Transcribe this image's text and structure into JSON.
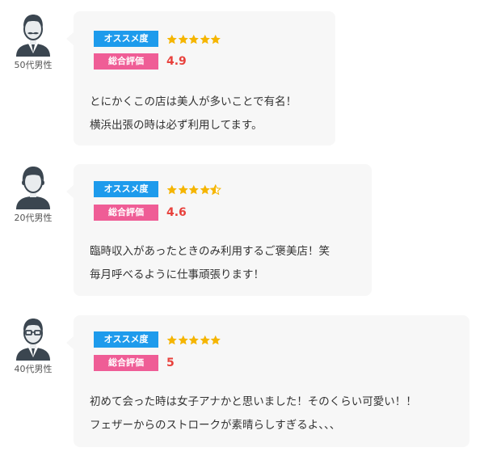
{
  "labels": {
    "recommend": "オススメ度",
    "overall": "総合評価"
  },
  "colors": {
    "recommend_tag": "#1e9bec",
    "overall_tag": "#ef5d96",
    "star": "#f5b500",
    "score_text": "#e8413c",
    "bubble_bg": "#f7f7f7",
    "avatar": "#3b4650"
  },
  "reviews": [
    {
      "age_label": "50代男性",
      "avatar_icon": "man-mustache-avatar-icon",
      "recommend_stars": 5,
      "overall_score": "4.9",
      "comment_lines": [
        "とにかくこの店は美人が多いことで有名！",
        "横浜出張の時は必ず利用してます。"
      ]
    },
    {
      "age_label": "20代男性",
      "avatar_icon": "young-man-avatar-icon",
      "recommend_stars": 4.5,
      "overall_score": "4.6",
      "comment_lines": [
        "臨時収入があったときのみ利用するご褒美店！笑",
        "毎月呼べるように仕事頑張ります！"
      ]
    },
    {
      "age_label": "40代男性",
      "avatar_icon": "man-glasses-avatar-icon",
      "recommend_stars": 5,
      "overall_score": "5",
      "comment_lines": [
        "初めて会った時は女子アナかと思いました！そのくらい可愛い！！",
        "フェザーからのストロークが素晴らしすぎるよ、、、"
      ]
    }
  ]
}
